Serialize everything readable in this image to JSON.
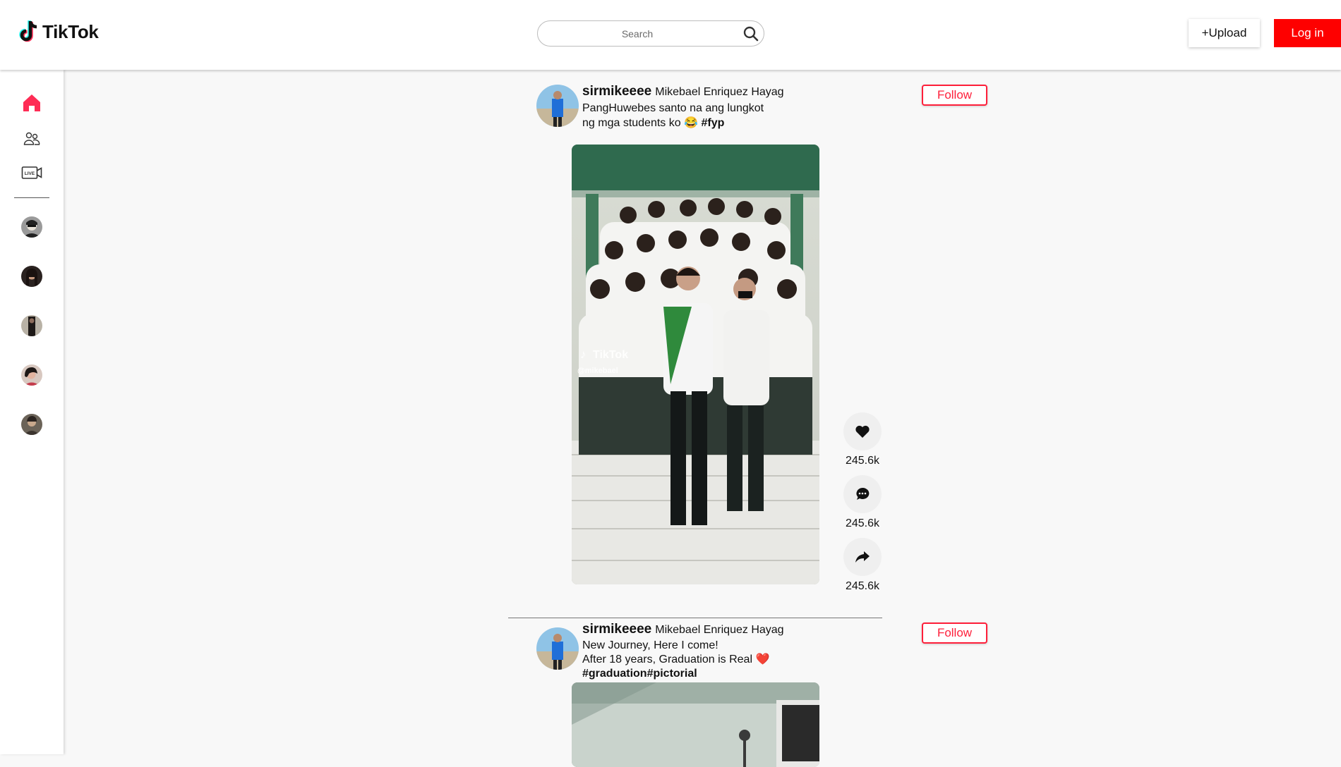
{
  "header": {
    "logo_text": "TikTok",
    "search_placeholder": "Search",
    "upload_label": "+Upload",
    "login_label": "Log in"
  },
  "sidebar": {
    "nav": [
      {
        "name": "home",
        "icon": "home-icon",
        "active": true
      },
      {
        "name": "following",
        "icon": "people-icon"
      },
      {
        "name": "live",
        "icon": "live-icon"
      }
    ],
    "accounts": 5
  },
  "posts": [
    {
      "username": "sirmikeeee",
      "nickname": "Mikebael Enriquez Hayag",
      "caption_lines": [
        "PangHuwebes santo na ang lungkot",
        "ng mga students ko 😂"
      ],
      "hashtags": "#fyp",
      "follow_label": "Follow",
      "video_watermark": "TikTok",
      "video_handle": "@mikebael",
      "likes": "245.6k",
      "comments": "245.6k",
      "shares": "245.6k"
    },
    {
      "username": "sirmikeeee",
      "nickname": "Mikebael Enriquez Hayag",
      "caption_lines": [
        "New Journey, Here I come!",
        "After 18 years, Graduation is Real ❤️"
      ],
      "hashtags": "#graduation#pictorial",
      "follow_label": "Follow"
    }
  ],
  "colors": {
    "accent_red": "#fe0000",
    "follow_red": "#fe1f3a",
    "home_active": "#fe2c55"
  }
}
